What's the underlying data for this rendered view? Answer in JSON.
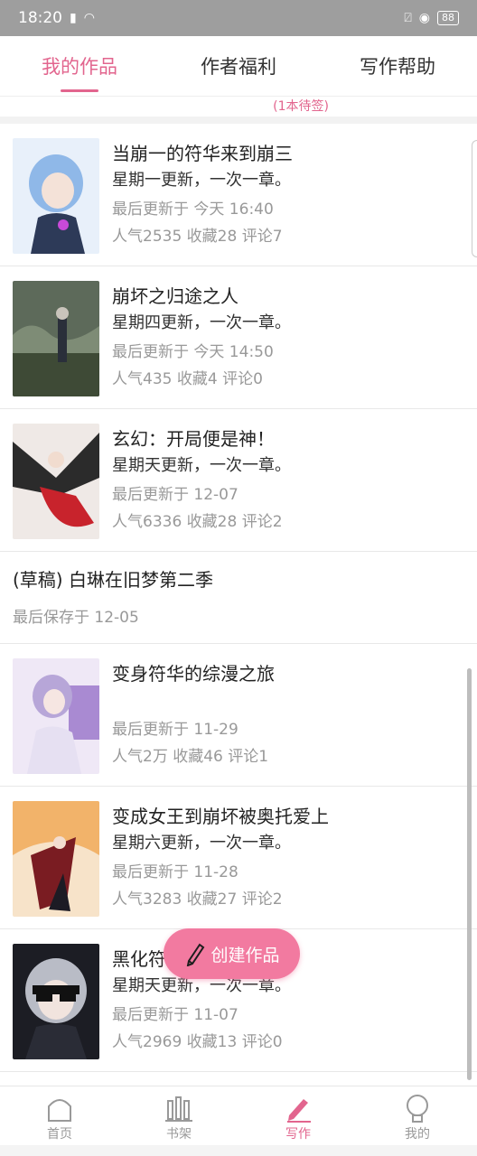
{
  "status_bar": {
    "time": "18:20",
    "battery": "88"
  },
  "tabs": [
    {
      "label": "我的作品",
      "active": true
    },
    {
      "label": "作者福利",
      "active": false
    },
    {
      "label": "写作帮助",
      "active": false
    }
  ],
  "pending_note": "(1本待签)",
  "works": [
    {
      "title": "当崩一的符华来到崩三",
      "schedule": "星期一更新，一次一章。",
      "updated": "最后更新于 今天 16:40",
      "stats": "人气2535  收藏28  评论7"
    },
    {
      "title": "崩坏之归途之人",
      "schedule": "星期四更新，一次一章。",
      "updated": "最后更新于 今天 14:50",
      "stats": "人气435  收藏4  评论0"
    },
    {
      "title": "玄幻：开局便是神！",
      "schedule": "星期天更新，一次一章。",
      "updated": "最后更新于 12-07",
      "stats": "人气6336  收藏28  评论2"
    }
  ],
  "draft": {
    "title": "(草稿) 白琳在旧梦第二季",
    "saved": "最后保存于 12-05"
  },
  "works_more": [
    {
      "title": "变身符华的综漫之旅",
      "schedule": "",
      "updated": "最后更新于 11-29",
      "stats": "人气2万  收藏46  评论1"
    },
    {
      "title": "变成女王到崩坏被奥托爱上",
      "schedule": "星期六更新，一次一章。",
      "updated": "最后更新于 11-28",
      "stats": "人气3283  收藏27  评论2"
    },
    {
      "title": "黑化符华",
      "schedule": "星期天更新，一次一章。",
      "updated": "最后更新于 11-07",
      "stats": "人气2969  收藏13  评论0"
    }
  ],
  "fab_label": "创建作品",
  "bottom_nav": [
    {
      "label": "首页",
      "icon": "home-icon",
      "active": false
    },
    {
      "label": "书架",
      "icon": "bookshelf-icon",
      "active": false
    },
    {
      "label": "写作",
      "icon": "pen-icon",
      "active": true
    },
    {
      "label": "我的",
      "icon": "profile-icon",
      "active": false
    }
  ],
  "colors": {
    "accent": "#e2658e",
    "fab": "#f27aa0",
    "muted": "#999999",
    "statusbar": "#9e9e9e"
  }
}
